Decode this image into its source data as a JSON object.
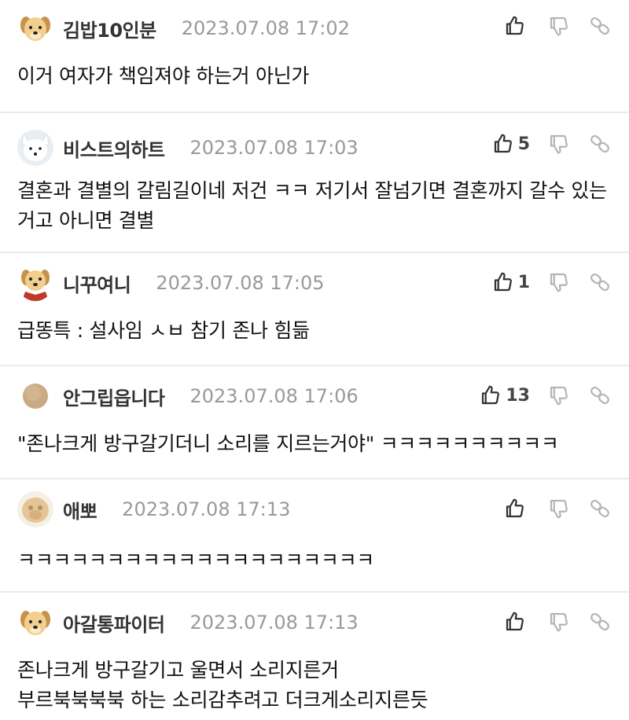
{
  "comments": [
    {
      "nick": "김밥10인분",
      "date": "2023.07.08 17:02",
      "likes": "",
      "text": "이거 여자가 책임져야 하는거 아닌가",
      "avatar": "puppy"
    },
    {
      "nick": "비스트의하트",
      "date": "2023.07.08 17:03",
      "likes": "5",
      "text": "결혼과 결별의 갈림길이네 저건 ㅋㅋ 저기서 잘넘기면 결혼까지 갈수 있는거고 아니면 결별",
      "avatar": "white-fox"
    },
    {
      "nick": "니꾸여니",
      "date": "2023.07.08 17:05",
      "likes": "1",
      "text": "급똥특 : 설사임 ㅅㅂ 참기 존나 힘듦",
      "avatar": "puppy-red"
    },
    {
      "nick": "안그립읍니다",
      "date": "2023.07.08 17:06",
      "likes": "13",
      "text": "\"존나크게 방구갈기더니 소리를 지르는거야\" ㅋㅋㅋㅋㅋㅋㅋㅋㅋㅋ",
      "avatar": "beige-circle"
    },
    {
      "nick": "애뽀",
      "date": "2023.07.08 17:13",
      "likes": "",
      "text": "ㅋㅋㅋㅋㅋㅋㅋㅋㅋㅋㅋㅋㅋㅋㅋㅋㅋㅋㅋㅋ",
      "avatar": "blurred-puppy"
    },
    {
      "nick": "아갈통파이터",
      "date": "2023.07.08 17:13",
      "likes": "",
      "text": "존나크게 방구갈기고 울면서 소리지른거\n부르북북북북 하는 소리감추려고 더크게소리지른듯",
      "avatar": "puppy"
    }
  ],
  "colors": {
    "divider": "#ebebeb",
    "date": "#999999",
    "icon": "#333333",
    "icon_muted": "#b5b5b5"
  },
  "icons": [
    "thumbs-up-icon",
    "thumbs-down-icon",
    "link-icon"
  ]
}
